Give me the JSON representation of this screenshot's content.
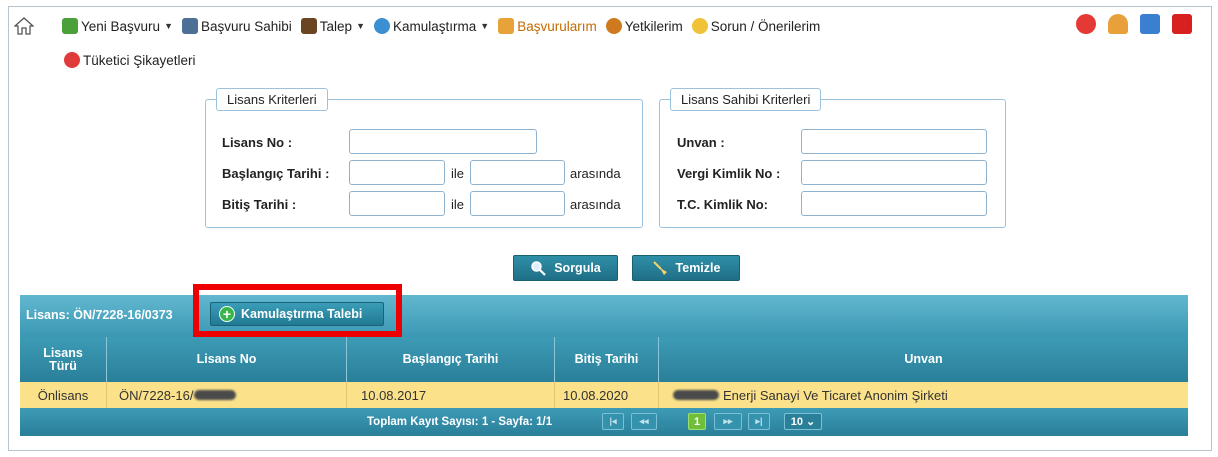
{
  "menu": {
    "items": [
      {
        "label": "Yeni Başvuru",
        "icon": "new-application-icon",
        "dropdown": true,
        "color": "#3a8f2a"
      },
      {
        "label": "Başvuru Sahibi",
        "icon": "users-icon",
        "dropdown": false,
        "color": "#2f5f8f"
      },
      {
        "label": "Talep",
        "icon": "book-icon",
        "dropdown": true,
        "color": "#5a3a1a"
      },
      {
        "label": "Kamulaştırma",
        "icon": "globe-icon",
        "dropdown": true,
        "color": "#2a7fc0"
      },
      {
        "label": "Başvurularım",
        "icon": "folder-icon",
        "dropdown": false,
        "color": "#d98a20"
      },
      {
        "label": "Yetkilerim",
        "icon": "people-icon",
        "dropdown": false,
        "color": "#c46a10"
      },
      {
        "label": "Sorun / Önerilerim",
        "icon": "chat-icon",
        "dropdown": false,
        "color": "#e6b820"
      }
    ],
    "second_row_item": {
      "label": "Tüketici Şikayetleri",
      "icon": "phone-alert-icon"
    },
    "right_icons": [
      "phone-alert-icon",
      "user-icon",
      "info-icon",
      "power-icon"
    ]
  },
  "license_criteria": {
    "legend": "Lisans Kriterleri",
    "license_no_label": "Lisans No :",
    "start_date_label": "Başlangıç Tarihi :",
    "end_date_label": "Bitiş Tarihi :",
    "ile": "ile",
    "arasinda": "arasında"
  },
  "owner_criteria": {
    "legend": "Lisans Sahibi Kriterleri",
    "title_label": "Unvan :",
    "tax_label": "Vergi Kimlik No :",
    "tc_label": "T.C. Kimlik No:"
  },
  "buttons": {
    "query": "Sorgula",
    "clear": "Temizle",
    "expropriation": "Kamulaştırma Talebi"
  },
  "panel": {
    "title": "Lisans: ÖN/7228-16/0373"
  },
  "table": {
    "headers": [
      "Lisans Türü",
      "Lisans No",
      "Başlangıç Tarihi",
      "Bitiş Tarihi",
      "Unvan"
    ],
    "row": {
      "type": "Önlisans",
      "license_no": "ÖN/7228-16/",
      "start": "10.08.2017",
      "end": "10.08.2020",
      "title": "Enerji Sanayi Ve Ticaret Anonim Şirketi"
    }
  },
  "pager": {
    "summary": "Toplam Kayıt Sayısı: 1 - Sayfa: 1/1",
    "current_page": "1",
    "page_size": "10"
  }
}
